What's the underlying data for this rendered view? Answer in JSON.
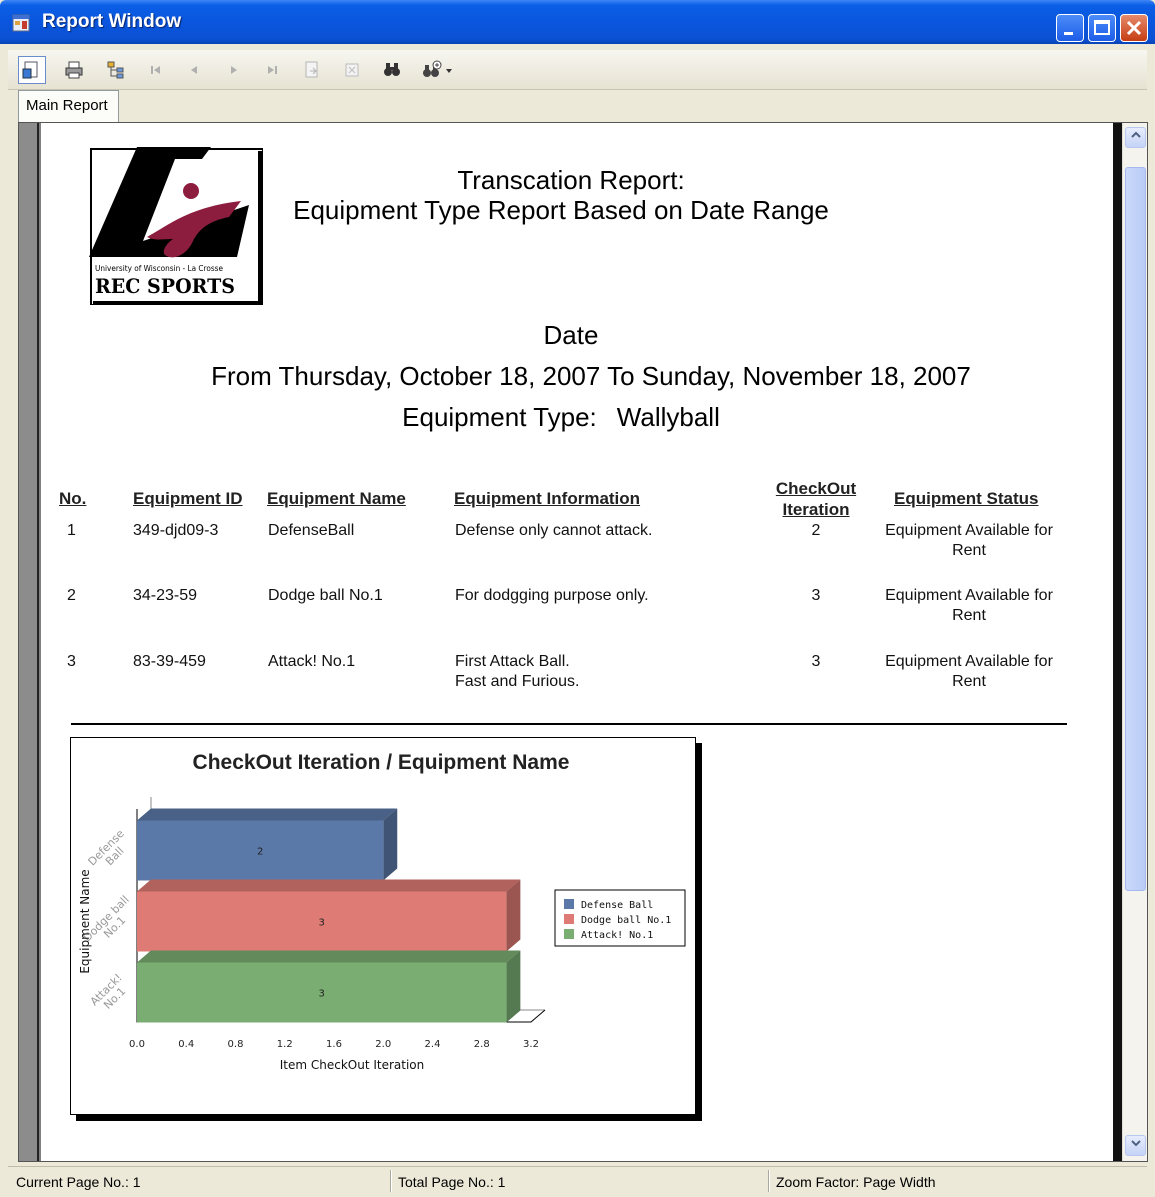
{
  "window": {
    "title": "Report Window"
  },
  "toolbar": {
    "icons": [
      "export-icon",
      "print-icon",
      "group-tree-icon",
      "first-page-icon",
      "previous-page-icon",
      "next-page-icon",
      "last-page-icon",
      "go-to-page-icon",
      "stop-icon",
      "search-icon",
      "zoom-icon"
    ]
  },
  "tabs": [
    {
      "label": "Main Report"
    }
  ],
  "report": {
    "logo": {
      "line1": "University of Wisconsin - La Crosse",
      "line2": "REC SPORTS"
    },
    "title_line1": "Transcation Report:",
    "title_line2": "Equipment Type Report Based on Date Range",
    "date_heading": "Date",
    "date_range": "From Thursday, October 18, 2007 To Sunday, November 18, 2007",
    "equipment_type_label": "Equipment Type:",
    "equipment_type_value": "Wallyball",
    "columns": {
      "no": "No.",
      "equipment_id": "Equipment ID",
      "equipment_name": "Equipment Name",
      "equipment_information": "Equipment Information",
      "checkout_line1": "CheckOut",
      "checkout_line2": "Iteration",
      "equipment_status": "Equipment Status"
    },
    "rows": [
      {
        "no": "1",
        "id": "349-djd09-3",
        "name": "DefenseBall",
        "info1": "Defense only cannot attack.",
        "info2": "",
        "checkout": "2",
        "status1": "Equipment Available for",
        "status2": "Rent"
      },
      {
        "no": "2",
        "id": "34-23-59",
        "name": "Dodge ball No.1",
        "info1": "For dodgging purpose only.",
        "info2": "",
        "checkout": "3",
        "status1": "Equipment Available for",
        "status2": "Rent"
      },
      {
        "no": "3",
        "id": "83-39-459",
        "name": "Attack! No.1",
        "info1": "First Attack Ball.",
        "info2": "Fast and Furious.",
        "checkout": "3",
        "status1": "Equipment Available for",
        "status2": "Rent"
      }
    ]
  },
  "chart_data": {
    "type": "bar",
    "orientation": "horizontal",
    "title": "CheckOut Iteration / Equipment Name",
    "xlabel": "Item CheckOut Iteration",
    "ylabel": "Equipment Name",
    "categories": [
      "Defense Ball",
      "Dodge ball No.1",
      "Attack! No.1"
    ],
    "values": [
      2,
      3,
      3
    ],
    "xlim": [
      0,
      3.2
    ],
    "xticks": [
      "0.0",
      "0.4",
      "0.8",
      "1.2",
      "1.6",
      "2.0",
      "2.4",
      "2.8",
      "3.2"
    ],
    "colors": [
      "#5b79a8",
      "#de7b74",
      "#7aad72"
    ],
    "legend": [
      "Defense Ball",
      "Dodge ball No.1",
      "Attack! No.1"
    ],
    "legend_position": "right",
    "three_d": true
  },
  "status": {
    "current_page": "Current Page No.: 1",
    "total_page": "Total Page No.: 1",
    "zoom": "Zoom Factor: Page Width"
  }
}
